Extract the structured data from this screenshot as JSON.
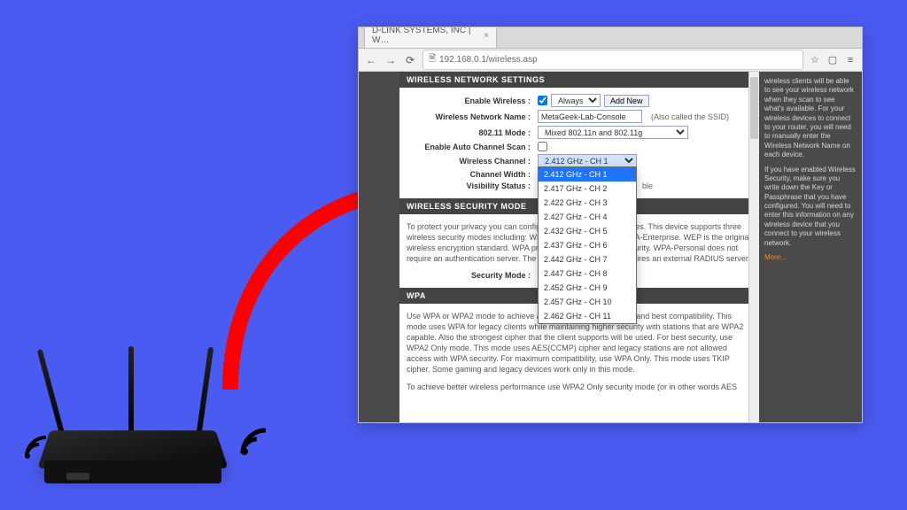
{
  "browser": {
    "tab_title": "D-LINK SYSTEMS, INC | W…",
    "url": "192.168.0.1/wireless.asp"
  },
  "sections": {
    "settings_header": "WIRELESS NETWORK SETTINGS",
    "security_header": "WIRELESS SECURITY MODE",
    "wpa_header": "WPA"
  },
  "fields": {
    "enable_wireless_label": "Enable Wireless :",
    "always_option": "Always",
    "add_new": "Add New",
    "name_label": "Wireless Network Name :",
    "name_value": "MetaGeek-Lab-Console",
    "name_hint": "(Also called the SSID)",
    "mode_label": "802.11 Mode :",
    "mode_value": "Mixed 802.11n and 802.11g",
    "auto_scan_label": "Enable Auto Channel Scan :",
    "channel_label": "Wireless Channel :",
    "channel_value": "2.412 GHz - CH 1",
    "width_label": "Channel Width :",
    "visibility_label": "Visibility Status :",
    "visibility_note": "ble",
    "security_mode_label": "Security Mode :"
  },
  "channel_options": [
    "2.412 GHz - CH 1",
    "2.417 GHz - CH 2",
    "2.422 GHz - CH 3",
    "2.427 GHz - CH 4",
    "2.432 GHz - CH 5",
    "2.437 GHz - CH 6",
    "2.442 GHz - CH 7",
    "2.447 GHz - CH 8",
    "2.452 GHz - CH 9",
    "2.457 GHz - CH 10",
    "2.462 GHz - CH 11"
  ],
  "security_text": "To protect your privacy you can configure wireless security features. This device supports three wireless security modes including: WEP, WPA-Personal, and WPA-Enterprise. WEP is the original wireless encryption standard. WPA provides a higher level of security. WPA-Personal does not require an authentication server. The WPA-Enterprise option requires an external RADIUS server.",
  "wpa_text1": "Use WPA or WPA2 mode to achieve a balance of strong security and best compatibility. This mode uses WPA for legacy clients while maintaining higher security with stations that are WPA2 capable. Also the strongest cipher that the client supports will be used. For best security, use WPA2 Only mode. This mode uses AES(CCMP) cipher and legacy stations are not allowed access with WPA security. For maximum compatibility, use WPA Only. This mode uses TKIP cipher. Some gaming and legacy devices work only in this mode.",
  "wpa_text2": "To achieve better wireless performance use WPA2 Only security mode (or in other words AES",
  "sidebar": {
    "p1": "wireless clients will be able to see your wireless network when they scan to see what's available. For your wireless devices to connect to your router, you will need to manually enter the Wireless Network Name on each device.",
    "p2": "If you have enabled Wireless Security, make sure you write down the Key or Passphrase that you have configured. You will need to enter this information on any wireless device that you connect to your wireless network.",
    "more": "More…"
  }
}
